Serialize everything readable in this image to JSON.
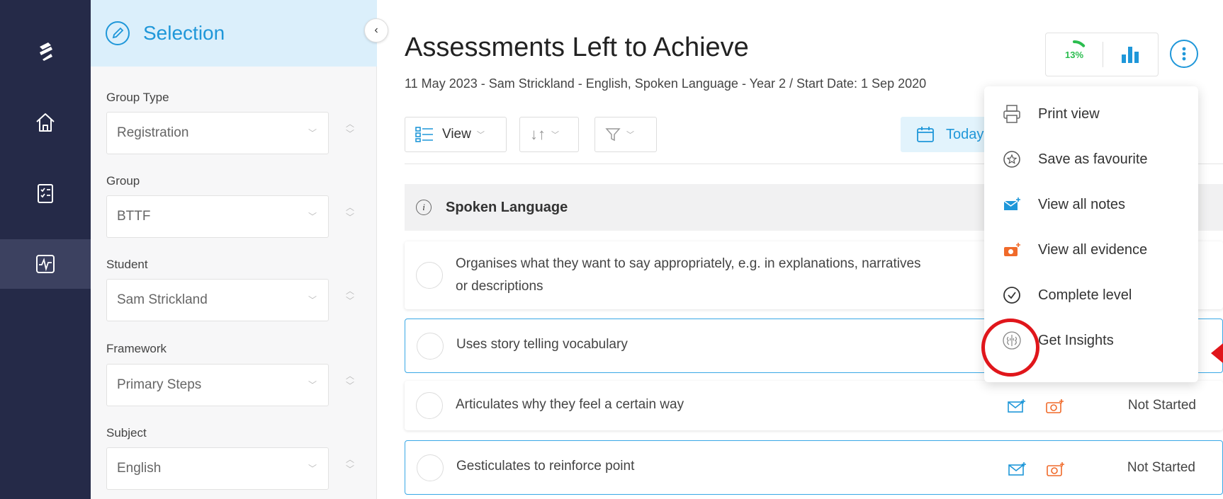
{
  "rail": {
    "items": [
      {
        "name": "logo",
        "icon": "logo-icon"
      },
      {
        "name": "home",
        "icon": "home-icon"
      },
      {
        "name": "assessments",
        "icon": "checklist-icon"
      },
      {
        "name": "activity",
        "icon": "pulse-icon",
        "active": true
      }
    ]
  },
  "panel": {
    "title": "Selection",
    "fields": [
      {
        "label": "Group Type",
        "value": "Registration"
      },
      {
        "label": "Group",
        "value": "BTTF"
      },
      {
        "label": "Student",
        "value": "Sam Strickland"
      },
      {
        "label": "Framework",
        "value": "Primary Steps"
      },
      {
        "label": "Subject",
        "value": "English"
      }
    ]
  },
  "main": {
    "title": "Assessments Left to Achieve",
    "subtitle": "11 May 2023 - Sam Strickland - English, Spoken Language - Year 2 / Start Date: 1 Sep 2020",
    "toolbar": {
      "view_label": "View",
      "today_label": "Today"
    },
    "progress_label": "13%",
    "progress_value": 0.13,
    "section_title": "Spoken Language",
    "rows": [
      {
        "text_line1": "Organises what they want to say appropriately, e.g. in explanations, narratives",
        "text_line2": "or descriptions",
        "status": ""
      },
      {
        "text_line1": "Uses story telling vocabulary",
        "text_line2": "",
        "status": ""
      },
      {
        "text_line1": "Articulates why they feel a certain way",
        "text_line2": "",
        "status": "Not Started"
      },
      {
        "text_line1": "Gesticulates to reinforce point",
        "text_line2": "",
        "status": "Not Started"
      }
    ]
  },
  "menu": {
    "items": [
      {
        "label": "Print view",
        "icon": "printer-icon"
      },
      {
        "label": "Save as favourite",
        "icon": "star-icon"
      },
      {
        "label": "View all notes",
        "icon": "notes-icon"
      },
      {
        "label": "View all evidence",
        "icon": "evidence-icon"
      },
      {
        "label": "Complete level",
        "icon": "check-circle-icon"
      },
      {
        "label": "Get Insights",
        "icon": "brain-icon"
      }
    ]
  },
  "colors": {
    "accent": "#1f97d9",
    "rail": "#252a48",
    "highlight": "#e0161b",
    "progress": "#2bbd4f"
  }
}
